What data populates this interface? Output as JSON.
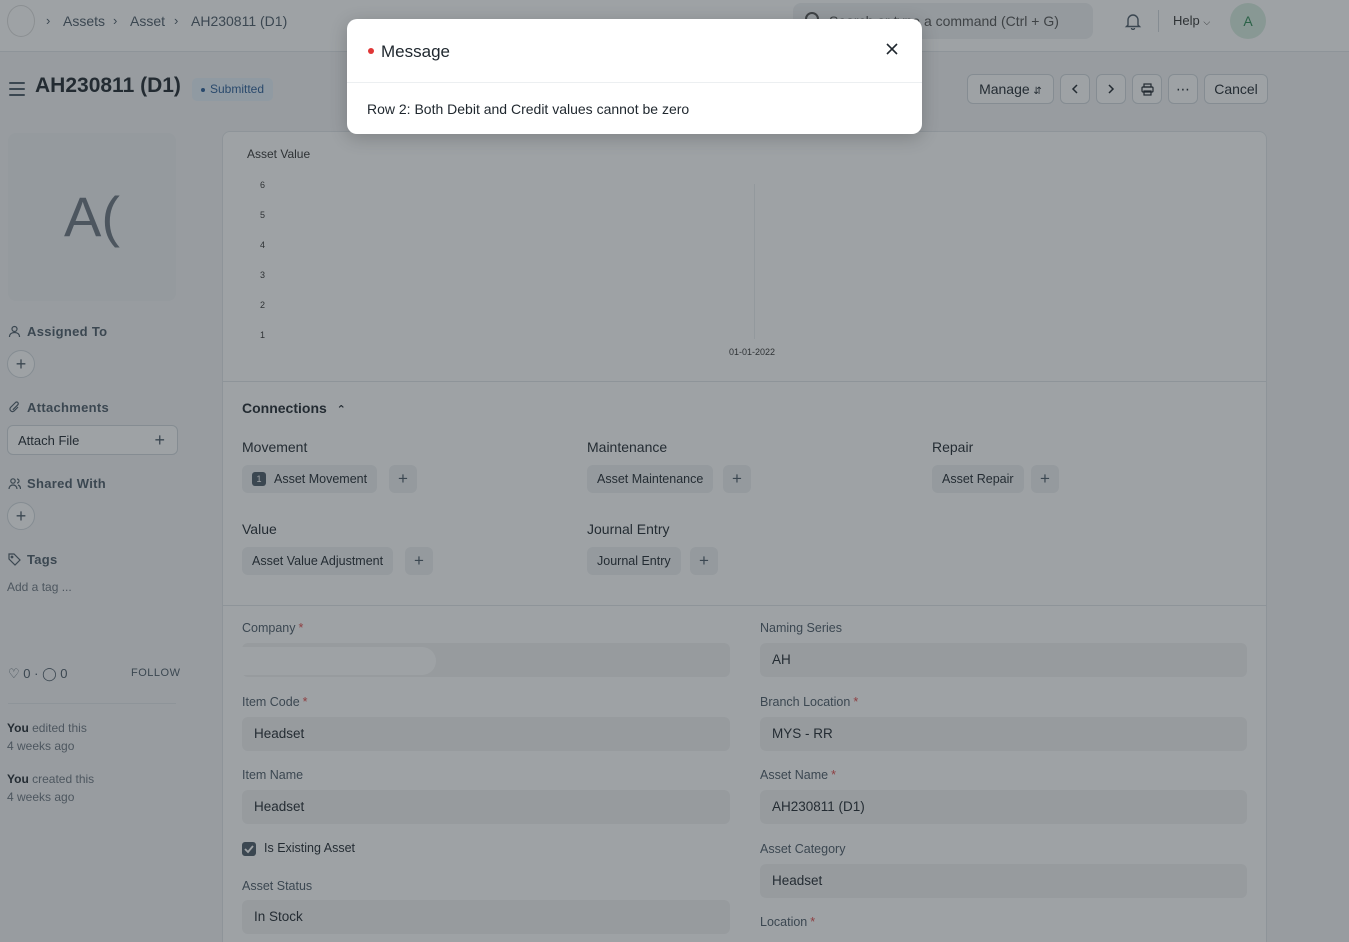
{
  "navbar": {
    "breadcrumbs": [
      "Assets",
      "Asset",
      "AH230811 (D1)"
    ],
    "search_placeholder": "Search or type a command (Ctrl + G)",
    "help_label": "Help",
    "avatar_letter": "A"
  },
  "page": {
    "title": "AH230811 (D1)",
    "status": "Submitted",
    "status_color": "#2a5d97",
    "actions": {
      "manage": "Manage",
      "cancel": "Cancel"
    }
  },
  "sidebar": {
    "image_initials": "A(",
    "assigned_to": "Assigned To",
    "attachments": "Attachments",
    "attach_file": "Attach File",
    "shared_with": "Shared With",
    "tags": "Tags",
    "add_tag": "Add a tag ...",
    "likes": "0",
    "comments": "0",
    "follow": "FOLLOW",
    "activity": [
      {
        "who": "You",
        "what": "edited this",
        "when": "4 weeks ago"
      },
      {
        "who": "You",
        "what": "created this",
        "when": "4 weeks ago"
      }
    ]
  },
  "chart_data": {
    "type": "line",
    "title": "Asset Value",
    "x": [
      "01-01-2022"
    ],
    "y_ticks": [
      1,
      2,
      3,
      4,
      5,
      6
    ],
    "series": []
  },
  "connections": {
    "heading": "Connections",
    "groups": [
      {
        "title": "Movement",
        "items": [
          {
            "label": "Asset Movement",
            "count": "1"
          }
        ]
      },
      {
        "title": "Maintenance",
        "items": [
          {
            "label": "Asset Maintenance"
          }
        ]
      },
      {
        "title": "Repair",
        "items": [
          {
            "label": "Asset Repair"
          }
        ]
      },
      {
        "title": "Value",
        "items": [
          {
            "label": "Asset Value Adjustment"
          }
        ]
      },
      {
        "title": "Journal Entry",
        "items": [
          {
            "label": "Journal Entry"
          }
        ]
      }
    ]
  },
  "form": {
    "company_label": "Company",
    "naming_series_label": "Naming Series",
    "naming_series_value": "AH",
    "item_code_label": "Item Code",
    "item_code_value": "Headset",
    "branch_location_label": "Branch Location",
    "branch_location_value": "MYS - RR",
    "item_name_label": "Item Name",
    "item_name_value": "Headset",
    "asset_name_label": "Asset Name",
    "asset_name_value": "AH230811 (D1)",
    "is_existing_label": "Is Existing Asset",
    "asset_category_label": "Asset Category",
    "asset_category_value": "Headset",
    "asset_status_label": "Asset Status",
    "asset_status_value": "In Stock",
    "location_label": "Location"
  },
  "modal": {
    "title": "Message",
    "message": "Row 2: Both Debit and Credit values cannot be zero"
  }
}
